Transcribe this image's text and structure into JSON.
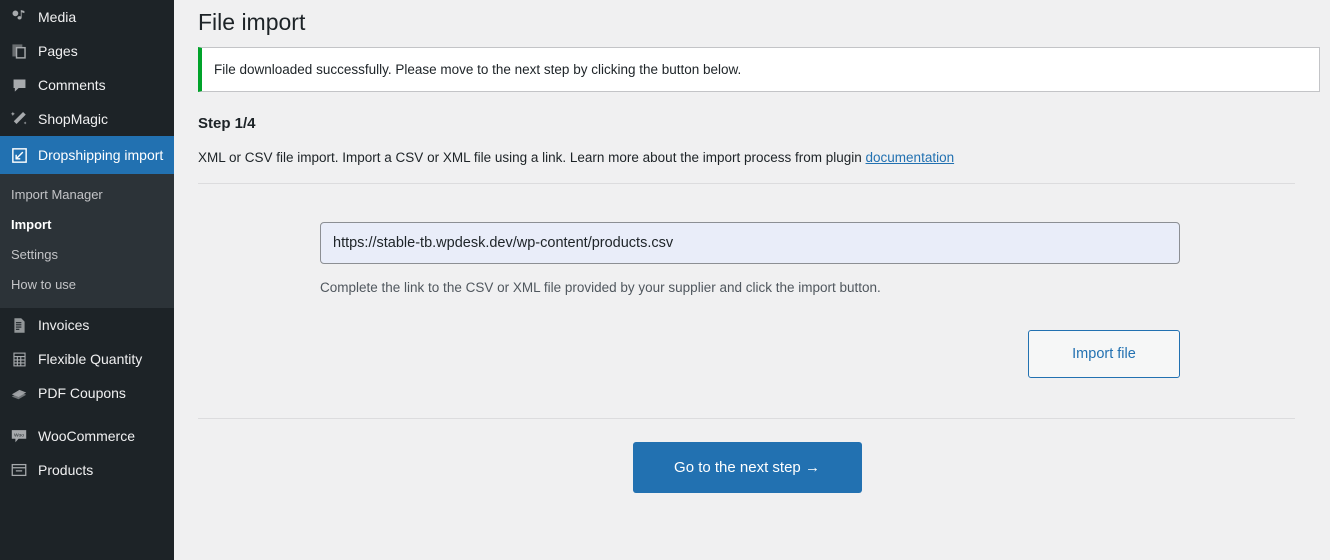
{
  "sidebar": {
    "items": [
      {
        "label": "Media",
        "icon": "media-icon"
      },
      {
        "label": "Pages",
        "icon": "pages-icon"
      },
      {
        "label": "Comments",
        "icon": "comments-icon"
      },
      {
        "label": "ShopMagic",
        "icon": "shopmagic-icon"
      }
    ],
    "active_item": {
      "label": "Dropshipping import",
      "icon": "dropshipping-import-icon"
    },
    "submenu": [
      {
        "label": "Import Manager",
        "current": false
      },
      {
        "label": "Import",
        "current": true
      },
      {
        "label": "Settings",
        "current": false
      },
      {
        "label": "How to use",
        "current": false
      }
    ],
    "items_lower": [
      {
        "label": "Invoices",
        "icon": "invoices-icon"
      },
      {
        "label": "Flexible Quantity",
        "icon": "flexible-quantity-icon"
      },
      {
        "label": "PDF Coupons",
        "icon": "pdf-coupons-icon"
      }
    ],
    "items_lower2": [
      {
        "label": "WooCommerce",
        "icon": "woocommerce-icon"
      },
      {
        "label": "Products",
        "icon": "products-icon"
      }
    ],
    "colors": {
      "background": "#1d2327",
      "submenu_background": "#2c3338",
      "active_background": "#2271b1",
      "text": "#f0f0f1"
    }
  },
  "main": {
    "page_title": "File import",
    "notice": {
      "message": "File downloaded successfully. Please move to the next step by clicking the button below.",
      "accent_color": "#00a32a"
    },
    "step_heading": "Step 1/4",
    "step_description_before": "XML or CSV file import. Import a CSV or XML file using a link. Learn more about the import process from plugin ",
    "step_description_link": "documentation",
    "url_field": {
      "value": "https://stable-tb.wpdesk.dev/wp-content/products.csv",
      "placeholder": "https://stable-tb.wpdesk.dev/wp-content/products.csv",
      "hint": "Complete the link to the CSV or XML file provided by your supplier and click the import button."
    },
    "import_button_label": "Import file",
    "next_button_label": "Go to the next step →",
    "accent_color": "#2271b1"
  }
}
